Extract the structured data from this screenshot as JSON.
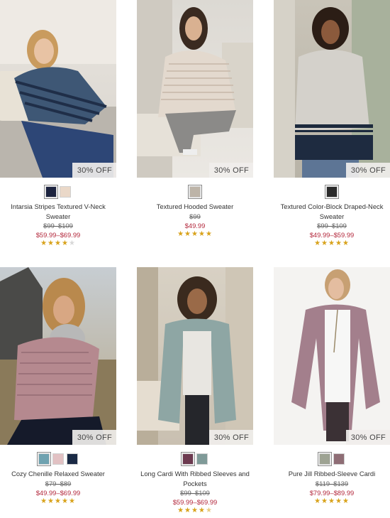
{
  "colors": {
    "sale": "#b3283c",
    "star": "#d8a21a"
  },
  "products": [
    {
      "name": "Intarsia Stripes Textured V-Neck Sweater",
      "badge": "30% OFF",
      "orig_price": "$99–$109",
      "sale_price": "$59.99–$69.99",
      "rating": 4,
      "swatches": [
        "#1d2440",
        "#ead8c8"
      ]
    },
    {
      "name": "Textured Hooded Sweater",
      "badge": "30% OFF",
      "orig_price": "$99",
      "sale_price": "$49.99",
      "rating": 5,
      "swatches": [
        "#bdb4a8"
      ]
    },
    {
      "name": "Textured Color-Block Draped-Neck Sweater",
      "badge": "30% OFF",
      "orig_price": "$99–$109",
      "sale_price": "$49.99–$59.99",
      "rating": 5,
      "swatches": [
        "#2b2b2b"
      ]
    },
    {
      "name": "Cozy Chenille Relaxed Sweater",
      "badge": "30% OFF",
      "orig_price": "$79–$89",
      "sale_price": "$49.99–$69.99",
      "rating": 5,
      "swatches": [
        "#6fa2b0",
        "#e2c1c3",
        "#1a2a45"
      ]
    },
    {
      "name": "Long Cardi With Ribbed Sleeves and Pockets",
      "badge": "30% OFF",
      "orig_price": "$99–$109",
      "sale_price": "$59.99–$69.99",
      "rating": 4.5,
      "swatches": [
        "#6d3a50",
        "#7f9a98"
      ]
    },
    {
      "name": "Pure Jill Ribbed-Sleeve Cardi",
      "badge": "30% OFF",
      "orig_price": "$119–$139",
      "sale_price": "$79.99–$89.99",
      "rating": 5,
      "swatches": [
        "#9ea393",
        "#8e6d75"
      ]
    }
  ]
}
